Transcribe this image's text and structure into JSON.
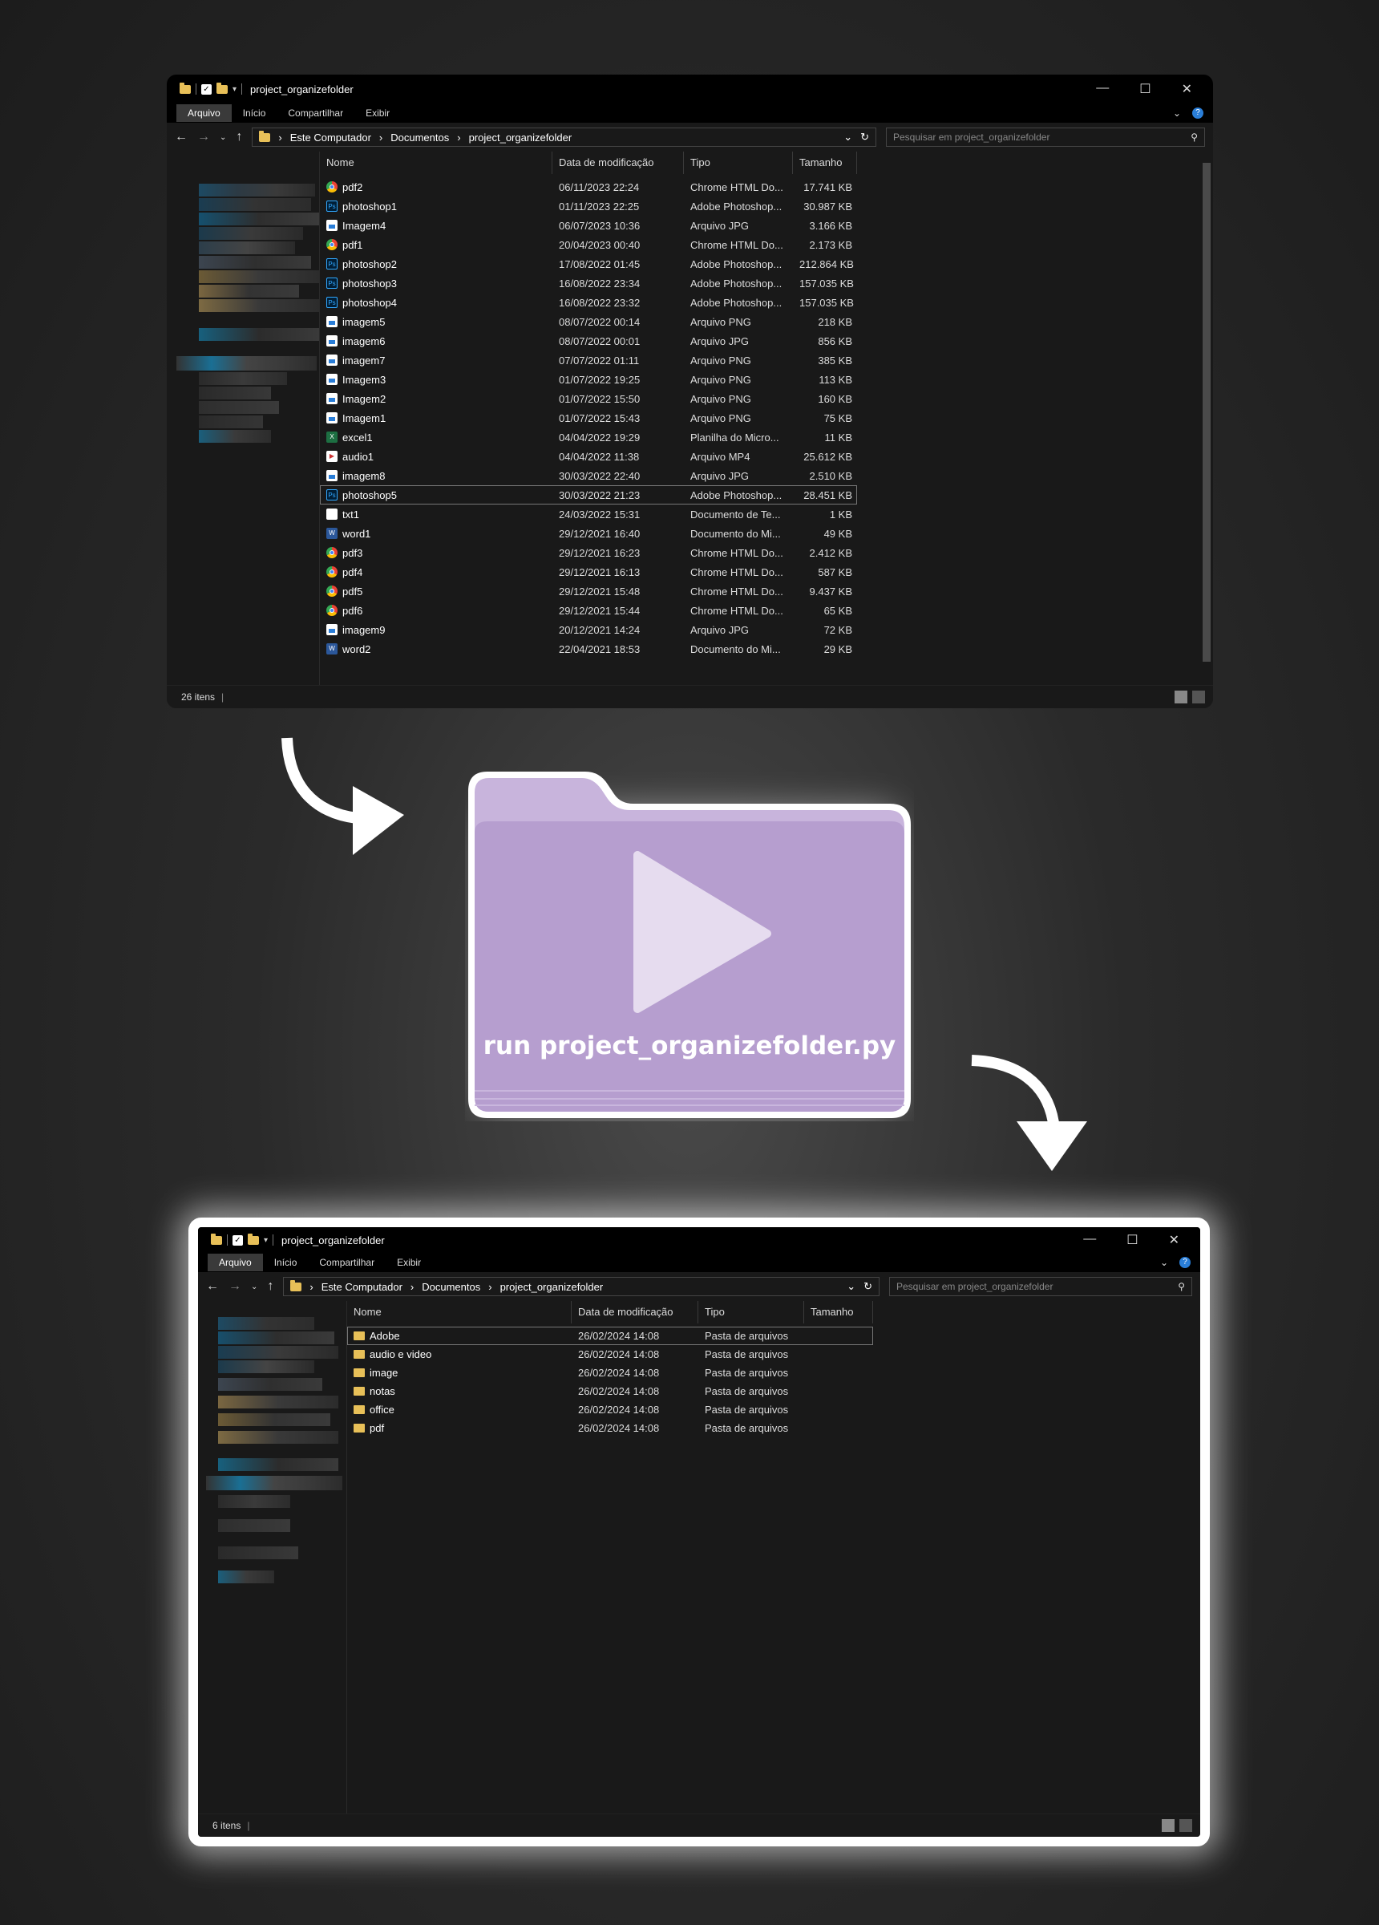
{
  "window_before": {
    "title": "project_organizefolder",
    "ribbon_tabs": [
      "Arquivo",
      "Início",
      "Compartilhar",
      "Exibir"
    ],
    "path": [
      "Este Computador",
      "Documentos",
      "project_organizefolder"
    ],
    "search_placeholder": "Pesquisar em project_organizefolder",
    "columns": {
      "name": "Nome",
      "date": "Data de modificação",
      "type": "Tipo",
      "size": "Tamanho"
    },
    "status": "26 itens",
    "rows": [
      {
        "icon": "chrome",
        "name": "pdf2",
        "date": "06/11/2023 22:24",
        "type": "Chrome HTML Do...",
        "size": "17.741 KB"
      },
      {
        "icon": "ps",
        "name": "photoshop1",
        "date": "01/11/2023 22:25",
        "type": "Adobe Photoshop...",
        "size": "30.987 KB"
      },
      {
        "icon": "img",
        "name": "Imagem4",
        "date": "06/07/2023 10:36",
        "type": "Arquivo JPG",
        "size": "3.166 KB"
      },
      {
        "icon": "chrome",
        "name": "pdf1",
        "date": "20/04/2023 00:40",
        "type": "Chrome HTML Do...",
        "size": "2.173 KB"
      },
      {
        "icon": "ps",
        "name": "photoshop2",
        "date": "17/08/2022 01:45",
        "type": "Adobe Photoshop...",
        "size": "212.864 KB"
      },
      {
        "icon": "ps",
        "name": "photoshop3",
        "date": "16/08/2022 23:34",
        "type": "Adobe Photoshop...",
        "size": "157.035 KB"
      },
      {
        "icon": "ps",
        "name": "photoshop4",
        "date": "16/08/2022 23:32",
        "type": "Adobe Photoshop...",
        "size": "157.035 KB"
      },
      {
        "icon": "img",
        "name": "imagem5",
        "date": "08/07/2022 00:14",
        "type": "Arquivo PNG",
        "size": "218 KB"
      },
      {
        "icon": "img",
        "name": "imagem6",
        "date": "08/07/2022 00:01",
        "type": "Arquivo JPG",
        "size": "856 KB"
      },
      {
        "icon": "img",
        "name": "imagem7",
        "date": "07/07/2022 01:11",
        "type": "Arquivo PNG",
        "size": "385 KB"
      },
      {
        "icon": "img",
        "name": "Imagem3",
        "date": "01/07/2022 19:25",
        "type": "Arquivo PNG",
        "size": "113 KB"
      },
      {
        "icon": "img",
        "name": "Imagem2",
        "date": "01/07/2022 15:50",
        "type": "Arquivo PNG",
        "size": "160 KB"
      },
      {
        "icon": "img",
        "name": "Imagem1",
        "date": "01/07/2022 15:43",
        "type": "Arquivo PNG",
        "size": "75 KB"
      },
      {
        "icon": "xls",
        "name": "excel1",
        "date": "04/04/2022 19:29",
        "type": "Planilha do Micro...",
        "size": "11 KB"
      },
      {
        "icon": "mp4",
        "name": "audio1",
        "date": "04/04/2022 11:38",
        "type": "Arquivo MP4",
        "size": "25.612 KB"
      },
      {
        "icon": "img",
        "name": "imagem8",
        "date": "30/03/2022 22:40",
        "type": "Arquivo JPG",
        "size": "2.510 KB"
      },
      {
        "icon": "ps",
        "name": "photoshop5",
        "date": "30/03/2022 21:23",
        "type": "Adobe Photoshop...",
        "size": "28.451 KB",
        "selected": true
      },
      {
        "icon": "txt",
        "name": "txt1",
        "date": "24/03/2022 15:31",
        "type": "Documento de Te...",
        "size": "1 KB"
      },
      {
        "icon": "doc",
        "name": "word1",
        "date": "29/12/2021 16:40",
        "type": "Documento do Mi...",
        "size": "49 KB"
      },
      {
        "icon": "chrome",
        "name": "pdf3",
        "date": "29/12/2021 16:23",
        "type": "Chrome HTML Do...",
        "size": "2.412 KB"
      },
      {
        "icon": "chrome",
        "name": "pdf4",
        "date": "29/12/2021 16:13",
        "type": "Chrome HTML Do...",
        "size": "587 KB"
      },
      {
        "icon": "chrome",
        "name": "pdf5",
        "date": "29/12/2021 15:48",
        "type": "Chrome HTML Do...",
        "size": "9.437 KB"
      },
      {
        "icon": "chrome",
        "name": "pdf6",
        "date": "29/12/2021 15:44",
        "type": "Chrome HTML Do...",
        "size": "65 KB"
      },
      {
        "icon": "img",
        "name": "imagem9",
        "date": "20/12/2021 14:24",
        "type": "Arquivo JPG",
        "size": "72 KB"
      },
      {
        "icon": "doc",
        "name": "word2",
        "date": "22/04/2021 18:53",
        "type": "Documento do Mi...",
        "size": "29 KB"
      }
    ]
  },
  "center": {
    "label": "run project_organizefolder.py",
    "folder_color": "#b7a0cc",
    "play_icon": "play-icon"
  },
  "window_after": {
    "title": "project_organizefolder",
    "ribbon_tabs": [
      "Arquivo",
      "Início",
      "Compartilhar",
      "Exibir"
    ],
    "path": [
      "Este Computador",
      "Documentos",
      "project_organizefolder"
    ],
    "search_placeholder": "Pesquisar em project_organizefolder",
    "columns": {
      "name": "Nome",
      "date": "Data de modificação",
      "type": "Tipo",
      "size": "Tamanho"
    },
    "status": "6 itens",
    "rows": [
      {
        "icon": "fold",
        "name": "Adobe",
        "date": "26/02/2024 14:08",
        "type": "Pasta de arquivos",
        "size": "",
        "selected": true
      },
      {
        "icon": "fold",
        "name": "audio e video",
        "date": "26/02/2024 14:08",
        "type": "Pasta de arquivos",
        "size": ""
      },
      {
        "icon": "fold",
        "name": "image",
        "date": "26/02/2024 14:08",
        "type": "Pasta de arquivos",
        "size": ""
      },
      {
        "icon": "fold",
        "name": "notas",
        "date": "26/02/2024 14:08",
        "type": "Pasta de arquivos",
        "size": ""
      },
      {
        "icon": "fold",
        "name": "office",
        "date": "26/02/2024 14:08",
        "type": "Pasta de arquivos",
        "size": ""
      },
      {
        "icon": "fold",
        "name": "pdf",
        "date": "26/02/2024 14:08",
        "type": "Pasta de arquivos",
        "size": ""
      }
    ]
  }
}
